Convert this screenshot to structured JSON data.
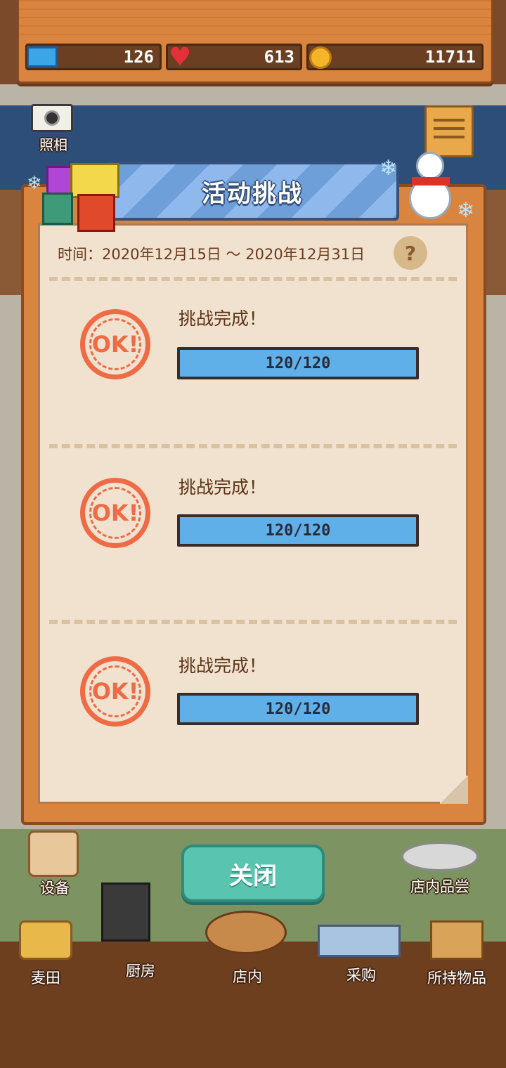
{
  "hud": {
    "tickets": "126",
    "hearts": "613",
    "coins": "11711"
  },
  "top_left_button": {
    "label": "照相",
    "icon": "camera-icon"
  },
  "dialog": {
    "title": "活动挑战",
    "time": "时间：2020年12月15日 ～ 2020年12月31日",
    "help": "?",
    "challenges": [
      {
        "status": "挑战完成！",
        "stamp": "OK!",
        "progress_text": "120/120",
        "progress": 1.0
      },
      {
        "status": "挑战完成！",
        "stamp": "OK!",
        "progress_text": "120/120",
        "progress": 1.0
      },
      {
        "status": "挑战完成！",
        "stamp": "OK!",
        "progress_text": "120/120",
        "progress": 1.0
      }
    ]
  },
  "close_label": "关闭",
  "side_buttons": {
    "equipment": "设备",
    "tasting": "店内品尝"
  },
  "bottom_nav": [
    "麦田",
    "厨房",
    "店内",
    "采购",
    "所持物品"
  ],
  "colors": {
    "accent": "#59c4b0",
    "stamp": "#ef6b45",
    "progress": "#5fb0e8",
    "banner": "#6f9fd9"
  }
}
